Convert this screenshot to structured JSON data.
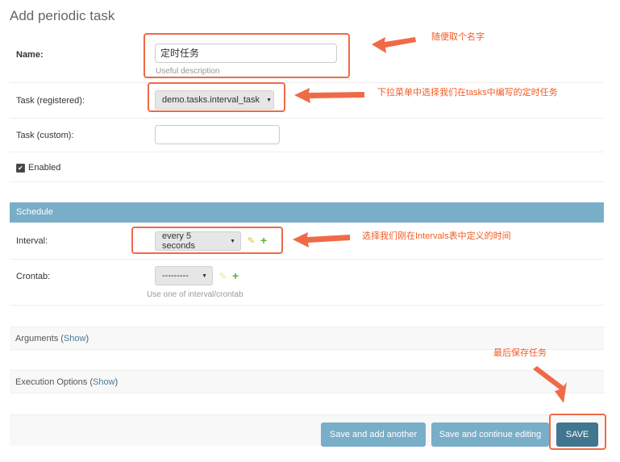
{
  "page": {
    "title": "Add periodic task"
  },
  "form": {
    "name": {
      "label": "Name:",
      "value": "定时任务",
      "help": "Useful description"
    },
    "task_registered": {
      "label": "Task (registered):",
      "selected": "demo.tasks.interval_task"
    },
    "task_custom": {
      "label": "Task (custom):",
      "value": ""
    },
    "enabled": {
      "label": "Enabled",
      "checked": true,
      "check_glyph": "✔"
    }
  },
  "schedule": {
    "title": "Schedule",
    "interval": {
      "label": "Interval:",
      "selected": "every 5 seconds"
    },
    "crontab": {
      "label": "Crontab:",
      "selected": "---------",
      "help": "Use one of interval/crontab"
    }
  },
  "sections": {
    "arguments": {
      "title": "Arguments",
      "open": " (",
      "toggle": "Show",
      "close": ")"
    },
    "execution": {
      "title": "Execution Options",
      "open": " (",
      "toggle": "Show",
      "close": ")"
    }
  },
  "buttons": {
    "save_add_another": "Save and add another",
    "save_continue": "Save and continue editing",
    "save": "SAVE"
  },
  "annotations": {
    "name": "随便取个名字",
    "task": "下拉菜单中选择我们在tasks中编写的定时任务",
    "interval": "选择我们刚在Intervals表中定义的时间",
    "save": "最后保存任务"
  },
  "icons": {
    "select_arrow": "▼",
    "edit": "✎",
    "add": "+"
  },
  "colors": {
    "module_header": "#79aec8",
    "primary_button": "#417690",
    "secondary_button": "#79aec8",
    "annotation": "#ef6a47",
    "link": "#447e9b"
  }
}
